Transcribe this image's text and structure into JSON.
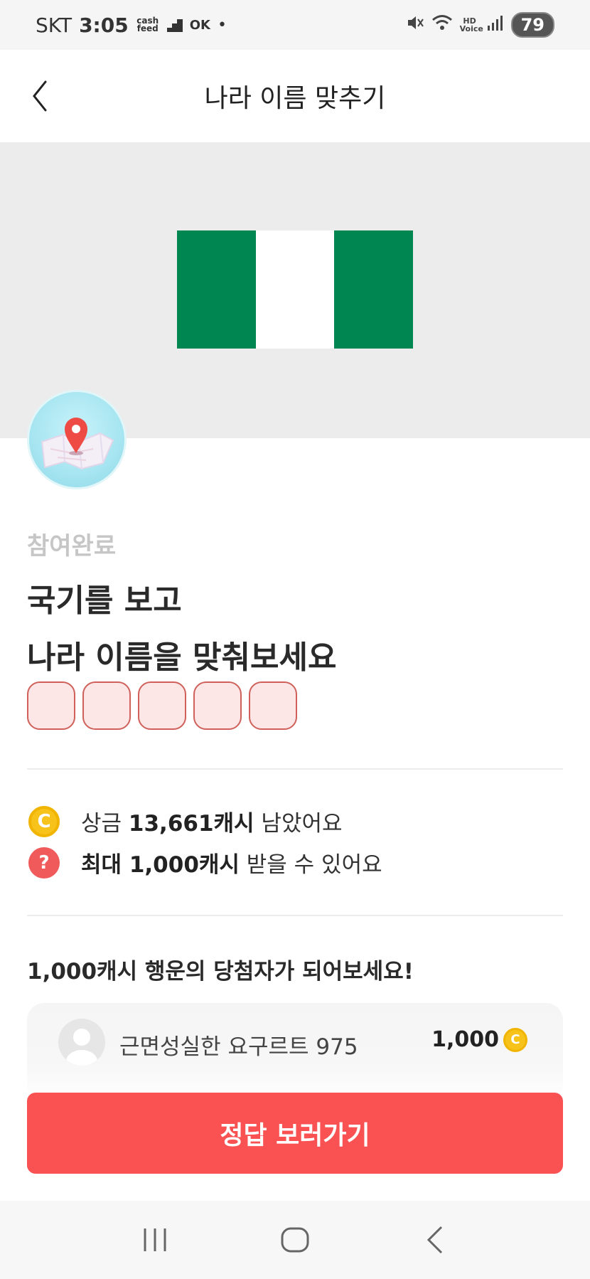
{
  "status_bar": {
    "carrier": "SKT",
    "time": "3:05",
    "app_badge_1": "cash feed",
    "app_badge_2": "OK",
    "hd_voice": "HD Voice",
    "battery": "79"
  },
  "header": {
    "title": "나라 이름 맞추기"
  },
  "quiz": {
    "status": "참여완료",
    "question_line1": "국기를 보고",
    "question_line2": "나라 이름을 맞춰보세요",
    "answer_slot_count": 5
  },
  "info": {
    "prize_prefix": "상금 ",
    "prize_amount": "13,661캐시",
    "prize_suffix": " 남았어요",
    "max_prefix": "최대 1,000캐시",
    "max_suffix": " 받을 수 있어요"
  },
  "winners": {
    "heading": "1,000캐시 행운의 당첨자가 되어보세요!",
    "items": [
      {
        "name": "근면성실한 요구르트 975",
        "amount": "1,000"
      }
    ]
  },
  "cta": {
    "label": "정답 보러가기"
  },
  "colors": {
    "accent": "#fa5252",
    "flag_green": "#008751",
    "coin": "#f7c21a"
  },
  "icons": {
    "back": "chevron-left-icon",
    "coin": "coin-icon",
    "question": "question-icon",
    "map_pin": "map-pin-icon"
  }
}
